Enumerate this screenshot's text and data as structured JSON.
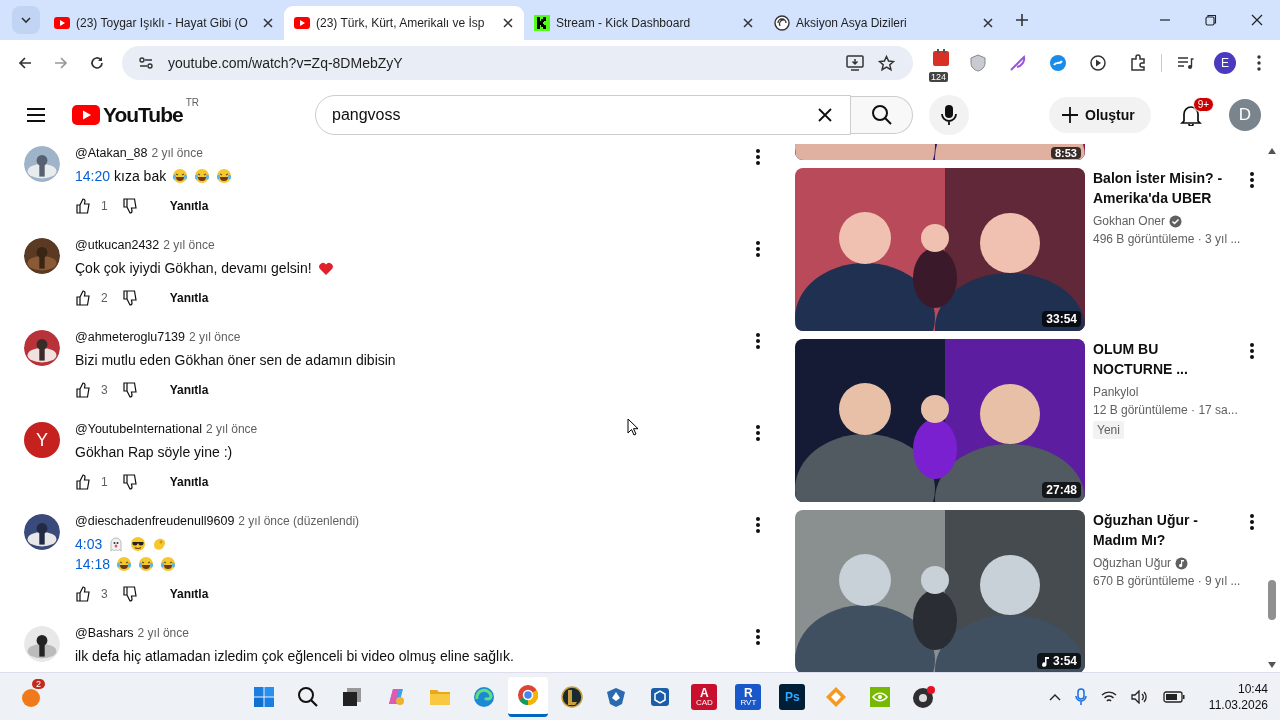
{
  "browser": {
    "tabs": [
      {
        "kind": "youtube",
        "title": "(23) Toygar Işıklı - Hayat Gibi (O",
        "selected": false
      },
      {
        "kind": "youtube",
        "title": "(23) Türk, Kürt, Amerikalı ve İsp",
        "selected": true
      },
      {
        "kind": "kick",
        "title": "Stream - Kick Dashboard",
        "selected": false
      },
      {
        "kind": "swirl",
        "title": "Aksiyon Asya Dizileri",
        "selected": false
      }
    ],
    "address": "youtube.com/watch?v=Zq-8DMebZyY",
    "extension_badge": "124",
    "profile": "E"
  },
  "youtube": {
    "logo": "YouTube",
    "region": "TR",
    "search": "pangvoss",
    "create": "Oluştur",
    "notifications": "9+",
    "avatar": "D"
  },
  "comments": [
    {
      "author": "@Atakan_88",
      "time": "2 yıl önce",
      "avatar": {
        "kind": "picture"
      },
      "lines": [
        {
          "timestamp": "14:20",
          "text": "kıza bak",
          "emojis": [
            {
              "kind": "laugh"
            },
            {
              "kind": "laugh"
            },
            {
              "kind": "laugh"
            }
          ]
        }
      ],
      "likes": "1",
      "reply": "Yanıtla"
    },
    {
      "author": "@utkucan2432",
      "time": "2 yıl önce",
      "avatar": {
        "kind": "picture"
      },
      "lines": [
        {
          "text": "Çok çok iyiydi Gökhan, devamı gelsin!",
          "emojis": [
            {
              "kind": "heart"
            }
          ]
        }
      ],
      "likes": "2",
      "reply": "Yanıtla"
    },
    {
      "author": "@ahmeteroglu7139",
      "time": "2 yıl önce",
      "avatar": {
        "kind": "picture"
      },
      "lines": [
        {
          "text": "Bizi mutlu eden Gökhan öner sen de adamın dibisin"
        }
      ],
      "likes": "3",
      "reply": "Yanıtla"
    },
    {
      "author": "@YoutubeInternational",
      "time": "2 yıl önce",
      "avatar": {
        "kind": "letter",
        "letter": "Y"
      },
      "lines": [
        {
          "text": "Gökhan Rap söyle yine :)"
        }
      ],
      "likes": "1",
      "reply": "Yanıtla"
    },
    {
      "author": "@dieschadenfreudenull9609",
      "time": "2 yıl önce (düzenlendi)",
      "avatar": {
        "kind": "picture"
      },
      "lines": [
        {
          "timestamp": "4:03",
          "emojis": [
            {
              "kind": "ghost"
            },
            {
              "kind": "cool"
            },
            {
              "kind": "pinch"
            }
          ]
        },
        {
          "timestamp": "14:18",
          "emojis": [
            {
              "kind": "laugh"
            },
            {
              "kind": "laugh"
            },
            {
              "kind": "laugh"
            }
          ]
        }
      ],
      "likes": "3",
      "reply": "Yanıtla"
    },
    {
      "author": "@Bashars",
      "time": "2 yıl önce",
      "avatar": {
        "kind": "picture"
      },
      "lines": [
        {
          "text": "ilk defa hiç atlamadan izledim çok eğlenceli bi video olmuş eline sağlık."
        }
      ]
    }
  ],
  "videos": [
    {
      "kind": "partial",
      "duration": "8:53"
    },
    {
      "kind": "full",
      "title": "Balon İster Misin? - Amerika'da UBER",
      "channel": "Gokhan Oner",
      "channel_badge": {
        "kind": "check"
      },
      "meta": "496 B görüntüleme · 3 yıl ...",
      "duration": "33:54"
    },
    {
      "kind": "full",
      "title": "OLUM BU NOCTURNE ...",
      "channel": "Pankylol",
      "meta": "12 B görüntüleme · 17 sa...",
      "badge": "Yeni",
      "duration": "27:48"
    },
    {
      "kind": "full",
      "title": "Oğuzhan Uğur - Madım Mı?",
      "channel": "Oğuzhan Uğur",
      "channel_badge": {
        "kind": "music"
      },
      "meta": "670 B görüntüleme · 9 yıl ...",
      "duration": "3:54",
      "duration_icon": {
        "kind": "music"
      }
    }
  ],
  "taskbar": {
    "notification_count": "2",
    "apps": [
      {
        "kind": "windows",
        "selected": false
      },
      {
        "kind": "search",
        "selected": false
      },
      {
        "kind": "taskview",
        "selected": false
      },
      {
        "kind": "copilot",
        "selected": false
      },
      {
        "kind": "folder",
        "selected": false
      },
      {
        "kind": "edge",
        "selected": false
      },
      {
        "kind": "chrome",
        "selected": true
      },
      {
        "kind": "league",
        "selected": false
      },
      {
        "kind": "rocket",
        "selected": false
      },
      {
        "kind": "cube",
        "selected": false
      },
      {
        "kind": "tile",
        "label": "A",
        "sublabel": "CAD",
        "selected": false
      },
      {
        "kind": "tile",
        "label": "R",
        "sublabel": "RVT",
        "selected": false
      },
      {
        "kind": "tile",
        "label": "Ps",
        "selected": false
      },
      {
        "kind": "diamond",
        "selected": false
      },
      {
        "kind": "nvidia",
        "selected": false
      },
      {
        "kind": "obs",
        "selected": false
      }
    ],
    "time": "10:44",
    "date": "11.03.2026"
  }
}
